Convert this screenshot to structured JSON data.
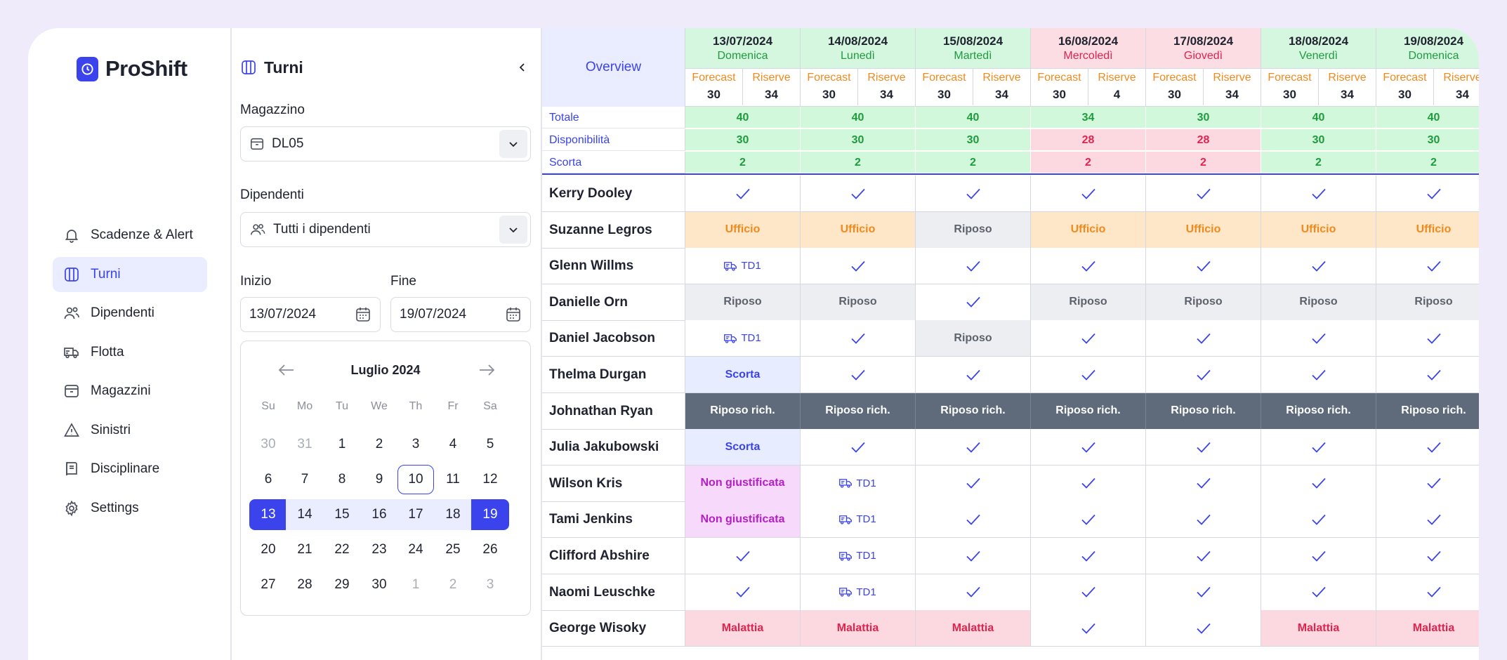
{
  "app": {
    "name": "ProShift",
    "brand_color": "#3a43ec"
  },
  "sidebar": {
    "items": [
      {
        "label": "Scadenze & Alert",
        "icon": "bell-icon",
        "active": false
      },
      {
        "label": "Turni",
        "icon": "columns-icon",
        "active": true
      },
      {
        "label": "Dipendenti",
        "icon": "users-icon",
        "active": false
      },
      {
        "label": "Flotta",
        "icon": "truck-icon",
        "active": false
      },
      {
        "label": "Magazzini",
        "icon": "box-icon",
        "active": false
      },
      {
        "label": "Sinistri",
        "icon": "warning-icon",
        "active": false
      },
      {
        "label": "Disciplinare",
        "icon": "book-icon",
        "active": false
      },
      {
        "label": "Settings",
        "icon": "gear-icon",
        "active": false
      }
    ]
  },
  "panel": {
    "title": "Turni",
    "warehouse_label": "Magazzino",
    "warehouse_value": "DL05",
    "employees_label": "Dipendenti",
    "employees_value": "Tutti i dipendenti",
    "start_label": "Inizio",
    "start_value": "13/07/2024",
    "end_label": "Fine",
    "end_value": "19/07/2024"
  },
  "calendar": {
    "month": "Luglio 2024",
    "weekdays": [
      "Su",
      "Mo",
      "Tu",
      "We",
      "Th",
      "Fr",
      "Sa"
    ],
    "weeks": [
      [
        "30",
        "31",
        "1",
        "2",
        "3",
        "4",
        "5"
      ],
      [
        "6",
        "7",
        "8",
        "9",
        "10",
        "11",
        "12"
      ],
      [
        "13",
        "14",
        "15",
        "16",
        "17",
        "18",
        "19"
      ],
      [
        "20",
        "21",
        "22",
        "23",
        "24",
        "25",
        "26"
      ],
      [
        "27",
        "28",
        "29",
        "30",
        "1",
        "2",
        "3"
      ]
    ]
  },
  "grid": {
    "overview_label": "Overview",
    "forecast_label": "Forecast",
    "reserve_label": "Riserve",
    "days": [
      {
        "date": "13/07/2024",
        "weekday": "Domenica",
        "status": "green",
        "forecast": "30",
        "reserve": "34"
      },
      {
        "date": "14/08/2024",
        "weekday": "Lunedì",
        "status": "green",
        "forecast": "30",
        "reserve": "34"
      },
      {
        "date": "15/08/2024",
        "weekday": "Martedì",
        "status": "green",
        "forecast": "30",
        "reserve": "34"
      },
      {
        "date": "16/08/2024",
        "weekday": "Mercoledì",
        "status": "red",
        "forecast": "30",
        "reserve": "4"
      },
      {
        "date": "17/08/2024",
        "weekday": "Giovedì",
        "status": "red",
        "forecast": "30",
        "reserve": "34"
      },
      {
        "date": "18/08/2024",
        "weekday": "Venerdì",
        "status": "green",
        "forecast": "30",
        "reserve": "34"
      },
      {
        "date": "19/08/2024",
        "weekday": "Domenica",
        "status": "green",
        "forecast": "30",
        "reserve": "34"
      }
    ],
    "summary": [
      {
        "label": "Totale",
        "values": [
          "40",
          "40",
          "40",
          "34",
          "30",
          "40",
          "40"
        ],
        "status": [
          "g",
          "g",
          "g",
          "g",
          "g",
          "g",
          "g"
        ]
      },
      {
        "label": "Disponibilità",
        "values": [
          "30",
          "30",
          "30",
          "28",
          "28",
          "30",
          "30"
        ],
        "status": [
          "g",
          "g",
          "g",
          "r",
          "r",
          "g",
          "g"
        ]
      },
      {
        "label": "Scorta",
        "values": [
          "2",
          "2",
          "2",
          "2",
          "2",
          "2",
          "2"
        ],
        "status": [
          "g",
          "g",
          "g",
          "r",
          "r",
          "g",
          "g"
        ]
      }
    ],
    "employees": [
      {
        "name": "Kerry Dooley",
        "shifts": [
          "check",
          "check",
          "check",
          "check",
          "check",
          "check",
          "check"
        ]
      },
      {
        "name": "Suzanne Legros",
        "shifts": [
          "ufficio",
          "ufficio",
          "riposo",
          "ufficio",
          "ufficio",
          "ufficio",
          "ufficio"
        ]
      },
      {
        "name": "Glenn Willms",
        "shifts": [
          "td1",
          "check",
          "check",
          "check",
          "check",
          "check",
          "check"
        ]
      },
      {
        "name": "Danielle Orn",
        "shifts": [
          "riposo",
          "riposo",
          "check",
          "riposo",
          "riposo",
          "riposo",
          "riposo"
        ]
      },
      {
        "name": "Daniel Jacobson",
        "shifts": [
          "td1",
          "check",
          "riposo",
          "check",
          "check",
          "check",
          "check"
        ]
      },
      {
        "name": "Thelma Durgan",
        "shifts": [
          "scorta",
          "check",
          "check",
          "check",
          "check",
          "check",
          "check"
        ]
      },
      {
        "name": "Johnathan Ryan",
        "shifts": [
          "riposo-rich",
          "riposo-rich",
          "riposo-rich",
          "riposo-rich",
          "riposo-rich",
          "riposo-rich",
          "riposo-rich"
        ]
      },
      {
        "name": "Julia Jakubowski",
        "shifts": [
          "scorta",
          "check",
          "check",
          "check",
          "check",
          "check",
          "check"
        ]
      },
      {
        "name": "Wilson Kris",
        "shifts": [
          "non-giust",
          "td1",
          "check",
          "check",
          "check",
          "check",
          "check"
        ]
      },
      {
        "name": "Tami Jenkins",
        "shifts": [
          "non-giust",
          "td1",
          "check",
          "check",
          "check",
          "check",
          "check"
        ]
      },
      {
        "name": "Clifford Abshire",
        "shifts": [
          "check",
          "td1",
          "check",
          "check",
          "check",
          "check",
          "check"
        ]
      },
      {
        "name": "Naomi Leuschke",
        "shifts": [
          "check",
          "td1",
          "check",
          "check",
          "check",
          "check",
          "check"
        ]
      },
      {
        "name": "George Wisoky",
        "shifts": [
          "malattia",
          "malattia",
          "malattia",
          "check",
          "check",
          "malattia",
          "malattia"
        ]
      }
    ],
    "shift_labels": {
      "ufficio": "Ufficio",
      "riposo": "Riposo",
      "scorta": "Scorta",
      "riposo-rich": "Riposo rich.",
      "non-giust": "Non giustificata",
      "malattia": "Malattia",
      "td1": "TD1"
    }
  }
}
